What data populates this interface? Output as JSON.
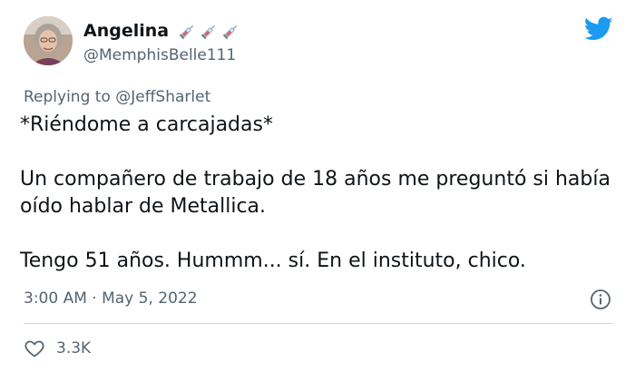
{
  "user": {
    "display_name": "Angelina",
    "handle": "@MemphisBelle111",
    "badge_icons": [
      "syringe-icon",
      "syringe-icon",
      "syringe-icon"
    ]
  },
  "reply": {
    "prefix": "Replying to ",
    "mention": "@JeffSharlet"
  },
  "tweet": {
    "lines": [
      "*Riéndome a carcajadas*",
      "Un compañero de trabajo de 18 años me preguntó si había oído hablar de Metallica.",
      "Tengo 51 años. Hummm... sí. En el instituto, chico."
    ],
    "timestamp": "3:00 AM · May 5, 2022",
    "likes": "3.3K"
  },
  "colors": {
    "twitter_blue": "#1d9bf0",
    "secondary_text": "#536471",
    "primary_text": "#0f1419"
  },
  "icons": {
    "logo": "twitter-bird-icon",
    "info": "info-icon",
    "like": "heart-icon"
  }
}
